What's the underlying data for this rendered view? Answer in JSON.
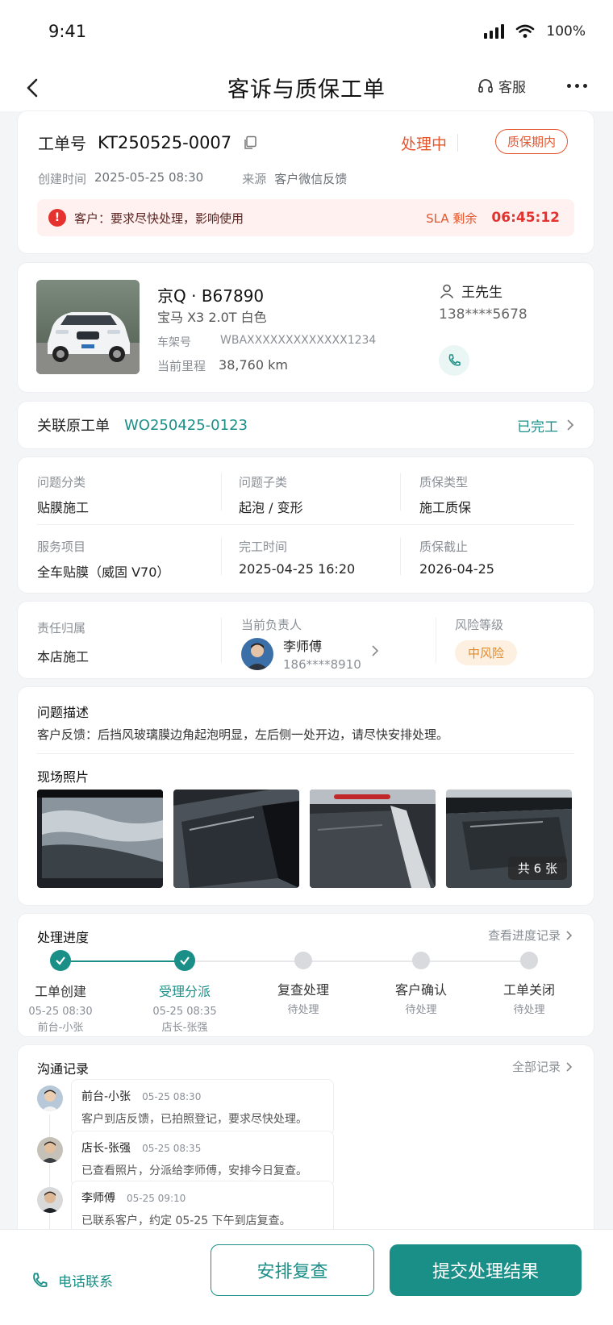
{
  "status_bar": {
    "time": "9:41",
    "battery": "100%"
  },
  "nav": {
    "title": "客诉与质保工单",
    "service_label": "客服"
  },
  "ticket": {
    "no_label": "工单号",
    "no": "KT250525-0007",
    "status": "处理中",
    "warranty_badge": "质保期内",
    "created_label": "创建时间",
    "created": "2025-05-25 08:30",
    "source_label": "来源",
    "source": "客户微信反馈",
    "alert": "客户：要求尽快处理，影响使用",
    "sla_label": "SLA 剩余",
    "sla_time": "06:45:12"
  },
  "vehicle": {
    "plate": "京Q · B67890",
    "model": "宝马 X3 2.0T 白色",
    "vin_label": "车架号",
    "vin": "WBAXXXXXXXXXXXXX1234",
    "mileage_label": "当前里程",
    "mileage": "38,760 km",
    "owner": "王先生",
    "owner_phone": "138****5678"
  },
  "related": {
    "label": "关联原工单",
    "order_no": "WO250425-0123",
    "status": "已完工"
  },
  "details": {
    "row1": [
      {
        "label": "问题分类",
        "value": "贴膜施工"
      },
      {
        "label": "问题子类",
        "value": "起泡 / 变形"
      },
      {
        "label": "质保类型",
        "value": "施工质保"
      }
    ],
    "row2": [
      {
        "label": "服务项目",
        "value": "全车贴膜（威固 V70）"
      },
      {
        "label": "完工时间",
        "value": "2025-04-25 16:20"
      },
      {
        "label": "质保截止",
        "value": "2026-04-25"
      }
    ]
  },
  "responsibility": {
    "owner_label": "责任归属",
    "owner_value": "本店施工",
    "assignee_label": "当前负责人",
    "assignee_name": "李师傅",
    "assignee_phone": "186****8910",
    "risk_label": "风险等级",
    "risk_value": "中风险"
  },
  "problem": {
    "title": "问题描述",
    "text": "客户反馈：后挡风玻璃膜边角起泡明显，左后侧一处开边，请尽快安排处理。",
    "photos_title": "现场照片",
    "photo_count": "共 6 张"
  },
  "progress": {
    "title": "处理进度",
    "link": "查看进度记录",
    "steps": [
      {
        "name": "工单创建",
        "time": "05-25 08:30",
        "who": "前台-小张",
        "done": true
      },
      {
        "name": "受理分派",
        "time": "05-25 08:35",
        "who": "店长-张强",
        "done": true
      },
      {
        "name": "复查处理",
        "time": "待处理",
        "who": "",
        "done": false
      },
      {
        "name": "客户确认",
        "time": "待处理",
        "who": "",
        "done": false
      },
      {
        "name": "工单关闭",
        "time": "待处理",
        "who": "",
        "done": false
      }
    ]
  },
  "comm": {
    "title": "沟通记录",
    "link": "全部记录",
    "messages": [
      {
        "name": "前台-小张",
        "time": "05-25 08:30",
        "text": "客户到店反馈，已拍照登记，要求尽快处理。"
      },
      {
        "name": "店长-张强",
        "time": "05-25 08:35",
        "text": "已查看照片，分派给李师傅，安排今日复查。"
      },
      {
        "name": "李师傅",
        "time": "05-25 09:10",
        "text": "已联系客户，约定 05-25 下午到店复查。"
      }
    ]
  },
  "bottom": {
    "call_label": "电话联系",
    "review_label": "安排复查",
    "submit_label": "提交处理结果"
  },
  "colors": {
    "accent": "#1a8f87",
    "danger": "#e4562e",
    "warning": "#e08a2a"
  }
}
